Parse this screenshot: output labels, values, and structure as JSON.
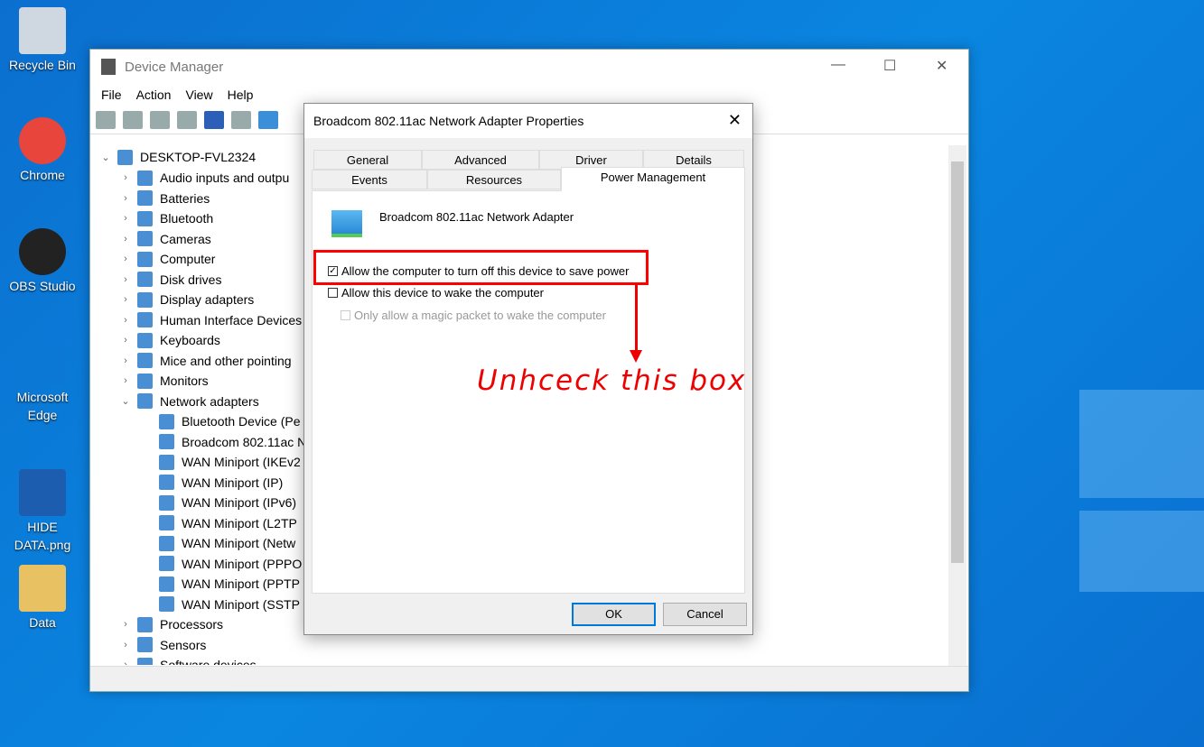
{
  "desktop": {
    "icons": [
      {
        "label": "Recycle Bin",
        "icon": "recycle-bin-icon"
      },
      {
        "label": "Chrome",
        "icon": "chrome-icon"
      },
      {
        "label": "OBS Studio",
        "icon": "obs-icon"
      },
      {
        "label": "Microsoft Edge",
        "icon": "edge-icon"
      },
      {
        "label": "HIDE DATA.png",
        "icon": "image-file-icon"
      },
      {
        "label": "Data",
        "icon": "folder-icon"
      }
    ]
  },
  "device_manager": {
    "title": "Device Manager",
    "menu": [
      "File",
      "Action",
      "View",
      "Help"
    ],
    "root": "DESKTOP-FVL2324",
    "categories": [
      "Audio inputs and outpu",
      "Batteries",
      "Bluetooth",
      "Cameras",
      "Computer",
      "Disk drives",
      "Display adapters",
      "Human Interface Devices",
      "Keyboards",
      "Mice and other pointing",
      "Monitors",
      "Network adapters"
    ],
    "network_children": [
      "Bluetooth Device (Pe",
      "Broadcom 802.11ac N",
      "WAN Miniport (IKEv2",
      "WAN Miniport (IP)",
      "WAN Miniport (IPv6)",
      "WAN Miniport (L2TP",
      "WAN Miniport (Netw",
      "WAN Miniport (PPPO",
      "WAN Miniport (PPTP",
      "WAN Miniport (SSTP"
    ],
    "after": [
      "Processors",
      "Sensors",
      "Software devices"
    ]
  },
  "dialog": {
    "title": "Broadcom 802.11ac Network Adapter Properties",
    "tabs_row1": [
      "General",
      "Advanced",
      "Driver",
      "Details"
    ],
    "tabs_row2": [
      "Events",
      "Resources",
      "Power Management"
    ],
    "active_tab": "Power Management",
    "device_name": "Broadcom 802.11ac Network Adapter",
    "options": [
      {
        "label": "Allow the computer to turn off this device to save power",
        "checked": true,
        "enabled": true
      },
      {
        "label": "Allow this device to wake the computer",
        "checked": false,
        "enabled": true
      },
      {
        "label": "Only allow a magic packet to wake the computer",
        "checked": false,
        "enabled": false
      }
    ],
    "ok": "OK",
    "cancel": "Cancel"
  },
  "annotation": {
    "text": "Unhceck this box",
    "color": "#ff0000"
  }
}
